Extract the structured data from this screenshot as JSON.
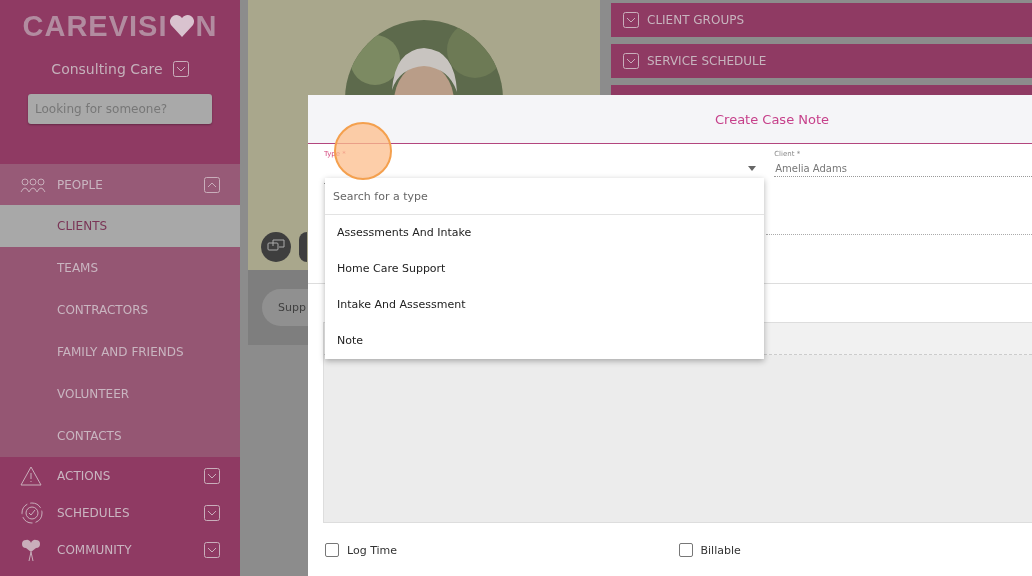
{
  "sidebar": {
    "logo": {
      "before": "CAREVISI",
      "after": "N"
    },
    "organisation": "Consulting Care",
    "search": {
      "placeholder": "Looking for someone?"
    },
    "nav": [
      {
        "label": "PEOPLE",
        "expanded": true,
        "children": [
          {
            "label": "CLIENTS",
            "selected": true
          },
          {
            "label": "TEAMS",
            "selected": false
          },
          {
            "label": "CONTRACTORS",
            "selected": false
          },
          {
            "label": "FAMILY AND FRIENDS",
            "selected": false
          },
          {
            "label": "VOLUNTEER",
            "selected": false
          },
          {
            "label": "CONTACTS",
            "selected": false
          }
        ]
      },
      {
        "label": "ACTIONS",
        "expanded": false
      },
      {
        "label": "SCHEDULES",
        "expanded": false
      },
      {
        "label": "COMMUNITY",
        "expanded": false
      }
    ]
  },
  "background": {
    "sections": [
      "CLIENT GROUPS",
      "SERVICE SCHEDULE"
    ],
    "chip": "Supp"
  },
  "modal": {
    "title": "Create Case Note",
    "type_field": {
      "label": "Type *"
    },
    "client_field": {
      "label": "Client *",
      "value": "Amelia Adams"
    },
    "dropdown": {
      "search": {
        "placeholder": "Search for a type"
      },
      "options": [
        "Assessments And Intake",
        "Home Care Support",
        "Intake And Assessment",
        "Note"
      ]
    },
    "checkboxes": [
      {
        "label": "Log Time",
        "checked": false
      },
      {
        "label": "Billable",
        "checked": false
      }
    ]
  }
}
